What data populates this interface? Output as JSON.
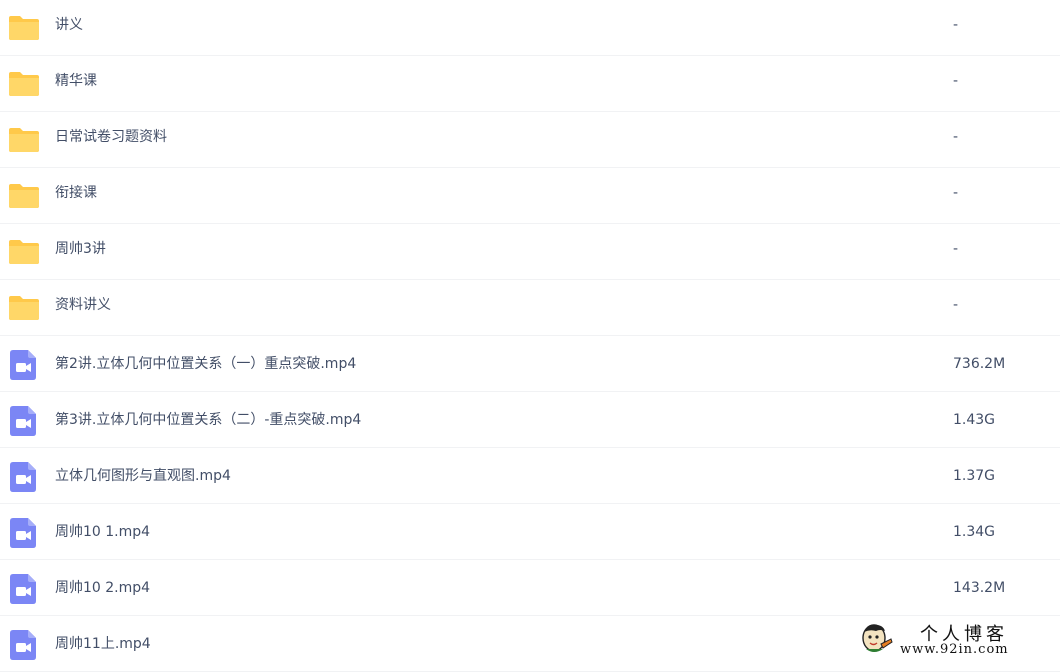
{
  "files": [
    {
      "type": "folder",
      "name": "讲义",
      "size": "-"
    },
    {
      "type": "folder",
      "name": "精华课",
      "size": "-"
    },
    {
      "type": "folder",
      "name": "日常试卷习题资料",
      "size": "-"
    },
    {
      "type": "folder",
      "name": "衔接课",
      "size": "-"
    },
    {
      "type": "folder",
      "name": "周帅3讲",
      "size": "-"
    },
    {
      "type": "folder",
      "name": "资料讲义",
      "size": "-"
    },
    {
      "type": "video",
      "name": "第2讲.立体几何中位置关系（一）重点突破.mp4",
      "size": "736.2M"
    },
    {
      "type": "video",
      "name": "第3讲.立体几何中位置关系（二）-重点突破.mp4",
      "size": "1.43G"
    },
    {
      "type": "video",
      "name": "立体几何图形与直观图.mp4",
      "size": "1.37G"
    },
    {
      "type": "video",
      "name": "周帅10 1.mp4",
      "size": "1.34G"
    },
    {
      "type": "video",
      "name": "周帅10 2.mp4",
      "size": "143.2M"
    },
    {
      "type": "video",
      "name": "周帅11上.mp4",
      "size": ""
    }
  ],
  "icons": {
    "folder": "folder-icon",
    "video": "video-file-icon"
  },
  "colors": {
    "folder": "#ffd768",
    "folder_tab": "#ffc94a",
    "video": "#7b86f5",
    "text": "#424e67",
    "divider": "#f1f2f4"
  },
  "watermark": {
    "title": "个人博客",
    "url": "www.92in.com"
  }
}
